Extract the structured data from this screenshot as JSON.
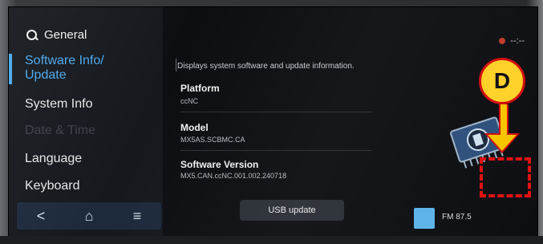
{
  "sidebar": {
    "header": "General",
    "items": [
      {
        "label": "Software Info/\nUpdate",
        "state": "active"
      },
      {
        "label": "System Info",
        "state": "normal"
      },
      {
        "label": "Date & Time",
        "state": "disabled"
      },
      {
        "label": "Language",
        "state": "normal"
      },
      {
        "label": "Keyboard",
        "state": "normal"
      }
    ],
    "nav": {
      "back": "<",
      "home": "⌂",
      "menu": "≡"
    }
  },
  "main": {
    "description": "Displays system software and update information.",
    "fields": [
      {
        "label": "Platform",
        "value": "ccNC"
      },
      {
        "label": "Model",
        "value": "MX5AS.SCBMC.CA"
      },
      {
        "label": "Software Version",
        "value": "MX5.CAN.ccNC.001.002.240718"
      }
    ],
    "usb_button": "USB update"
  },
  "status": {
    "time": "--:--"
  },
  "radio": {
    "label": "FM 87.5"
  },
  "callout": {
    "letter": "D"
  },
  "colors": {
    "accent": "#4aa9f0",
    "callout_fill": "#ffd12a",
    "callout_border": "#d20f0f"
  }
}
